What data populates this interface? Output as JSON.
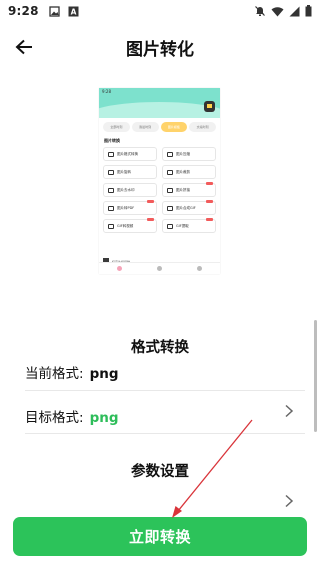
{
  "status_bar": {
    "time": "9:28"
  },
  "app_bar": {
    "title": "图片转化"
  },
  "preview": {
    "time": "9:28",
    "tabs": [
      "全部时刻",
      "我最时刻",
      "图片模板",
      "文案时刻"
    ],
    "section": "图片转换",
    "items": [
      {
        "label": "图片格式转换",
        "badge": false
      },
      {
        "label": "图片压缩",
        "badge": false
      },
      {
        "label": "图片旋转",
        "badge": false
      },
      {
        "label": "图片裁剪",
        "badge": false
      },
      {
        "label": "图片去水印",
        "badge": false
      },
      {
        "label": "图片拼接",
        "badge": true
      },
      {
        "label": "图片转PDF",
        "badge": true
      },
      {
        "label": "图片合成GIF",
        "badge": true
      },
      {
        "label": "GIF转视频",
        "badge": true
      },
      {
        "label": "GIF提取",
        "badge": true
      }
    ],
    "ad_text": "忆来先提货鲜"
  },
  "format_section": {
    "title": "格式转换",
    "current_label": "当前格式:",
    "current_value": "png",
    "target_label": "目标格式:",
    "target_value": "png"
  },
  "params_section": {
    "title": "参数设置"
  },
  "cta": {
    "label": "立即转换"
  },
  "colors": {
    "accent": "#2cc35a",
    "target_value": "#2ebd5a",
    "annotation": "#d9343a"
  }
}
